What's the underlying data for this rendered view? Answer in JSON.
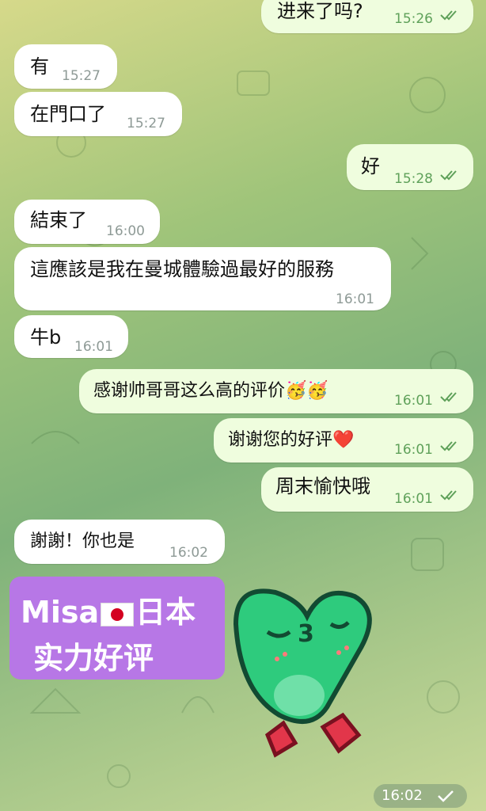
{
  "messages": [
    {
      "text": "进来了吗?",
      "time": "15:26"
    },
    {
      "text": "有",
      "time": "15:27"
    },
    {
      "text": "在門口了",
      "time": "15:27"
    },
    {
      "text": "好",
      "time": "15:28"
    },
    {
      "text": "結束了",
      "time": "16:00"
    },
    {
      "text": "這應該是我在曼城體驗過最好的服務",
      "time": "16:01"
    },
    {
      "text": "牛b",
      "time": "16:01"
    },
    {
      "text": "感谢帅哥哥这么高的评价🥳🥳",
      "time": "16:01"
    },
    {
      "text": "谢谢您的好评❤️",
      "time": "16:01"
    },
    {
      "text": "周末愉快哦",
      "time": "16:01"
    },
    {
      "text": "謝謝！你也是",
      "time": "16:02"
    }
  ],
  "badge": {
    "line1_a": "Misa",
    "line1_b": "日本",
    "line2": "实力好评"
  },
  "sticker": {
    "time": "16:02"
  },
  "colors": {
    "bubble_in": "#ffffff",
    "bubble_out": "#effdde",
    "badge": "#b777e6",
    "ticks": "#5fa15a"
  }
}
